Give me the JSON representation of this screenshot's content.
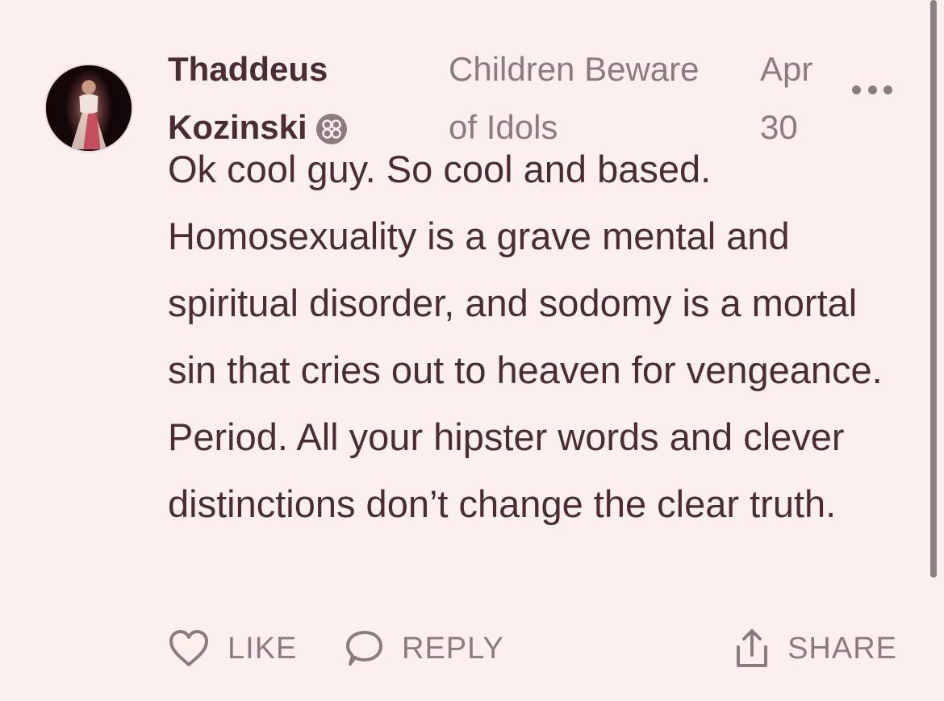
{
  "comment": {
    "author_line1": "Thaddeus",
    "author_line2": "Kozinski",
    "post_title_line1": "Children Beware",
    "post_title_line2": "of Idols",
    "date_line1": "Apr",
    "date_line2": "30",
    "body": "Ok cool guy. So cool and based. Homosexuality is a grave mental and spiritual disorder, and sodomy is a mortal sin that cries out to heaven for vengeance. Period. All your hipster words and clever distinctions don’t change the clear truth."
  },
  "actions": {
    "like_label": "LIKE",
    "reply_label": "REPLY",
    "share_label": "SHARE"
  },
  "icons": {
    "avatar": "divine-mercy-avatar",
    "badge": "subscriber-badge-icon",
    "more": "more-options-icon",
    "like": "heart-icon",
    "reply": "speech-bubble-icon",
    "share": "share-icon"
  },
  "colors": {
    "background": "#fcf0ef",
    "text": "#4a2d34",
    "muted": "#8a7b80"
  }
}
